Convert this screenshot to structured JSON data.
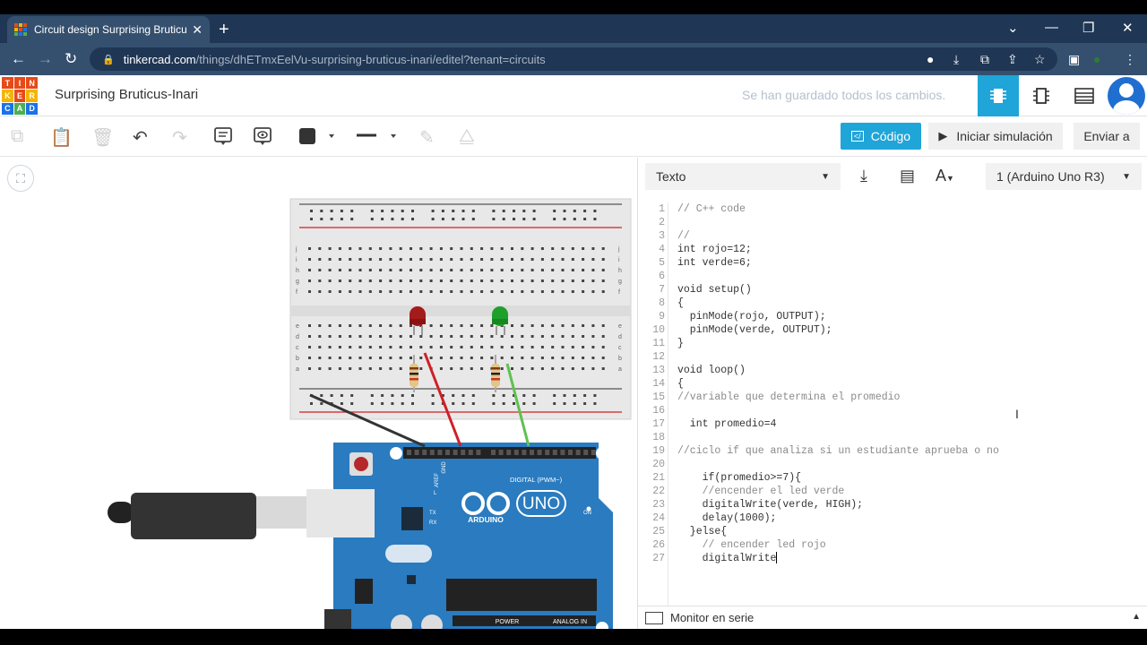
{
  "browser": {
    "tab_title": "Circuit design Surprising Bruticus-Inari",
    "tab_close": "✕",
    "new_tab": "+",
    "url_domain": "tinkercad.com",
    "url_path": "/things/dhETmxEelVu-surprising-bruticus-inari/editel?tenant=circuits"
  },
  "logo": {
    "letters": [
      "T",
      "I",
      "N",
      "K",
      "E",
      "R",
      "C",
      "A",
      "D"
    ],
    "colors": [
      "#e64a19",
      "#e64a19",
      "#e64a19",
      "#f4b400",
      "#e64a19",
      "#f4b400",
      "#1a73e8",
      "#4caf50",
      "#1a73e8"
    ]
  },
  "header": {
    "project_title": "Surprising Bruticus-Inari",
    "save_status": "Se han guardado todos los cambios."
  },
  "toolbar": {
    "code_button": "Código",
    "code_icon_label": "</",
    "simulate_button": "Iniciar simulación",
    "send_button": "Enviar a"
  },
  "code_panel": {
    "mode_select": "Texto",
    "device_select": "1 (Arduino Uno R3)",
    "serial_monitor": "Monitor en serie"
  },
  "code_lines": [
    {
      "n": "1",
      "t": "// C++ code",
      "c": true
    },
    {
      "n": "2",
      "t": "",
      "c": false
    },
    {
      "n": "3",
      "t": "//",
      "c": true
    },
    {
      "n": "4",
      "t": "int rojo=12;",
      "c": false
    },
    {
      "n": "5",
      "t": "int verde=6;",
      "c": false
    },
    {
      "n": "6",
      "t": "",
      "c": false
    },
    {
      "n": "7",
      "t": "void setup()",
      "c": false
    },
    {
      "n": "8",
      "t": "{",
      "c": false
    },
    {
      "n": "9",
      "t": "  pinMode(rojo, OUTPUT);",
      "c": false
    },
    {
      "n": "10",
      "t": "  pinMode(verde, OUTPUT);",
      "c": false
    },
    {
      "n": "11",
      "t": "}",
      "c": false
    },
    {
      "n": "12",
      "t": "",
      "c": false
    },
    {
      "n": "13",
      "t": "void loop()",
      "c": false
    },
    {
      "n": "14",
      "t": "{",
      "c": false
    },
    {
      "n": "15",
      "t": "//variable que determina el promedio",
      "c": true
    },
    {
      "n": "16",
      "t": "",
      "c": false
    },
    {
      "n": "17",
      "t": "  int promedio=4",
      "c": false
    },
    {
      "n": "18",
      "t": "",
      "c": false
    },
    {
      "n": "19",
      "t": "//ciclo if que analiza si un estudiante aprueba o no",
      "c": true
    },
    {
      "n": "20",
      "t": "",
      "c": false
    },
    {
      "n": "21",
      "t": "    if(promedio>=7){",
      "c": false
    },
    {
      "n": "22",
      "t": "    //encender el led verde",
      "c": true
    },
    {
      "n": "23",
      "t": "    digitalWrite(verde, HIGH);",
      "c": false
    },
    {
      "n": "24",
      "t": "    delay(1000);",
      "c": false
    },
    {
      "n": "25",
      "t": "  }else{",
      "c": false
    },
    {
      "n": "26",
      "t": "    // encender led rojo",
      "c": true
    },
    {
      "n": "27",
      "t": "    digitalWrite",
      "c": false
    }
  ],
  "breadboard": {
    "row_letters_top": [
      "j",
      "i",
      "h",
      "g",
      "f"
    ],
    "row_letters_bottom": [
      "e",
      "d",
      "c",
      "b",
      "a"
    ]
  },
  "arduino": {
    "brand": "ARDUINO",
    "model": "UNO",
    "digital_label": "DIGITAL (PWM~)",
    "power_label": "POWER",
    "analog_label": "ANALOG IN",
    "aref_label": "AREF",
    "gnd_label": "GND",
    "on_label": "ON",
    "tx_label": "TX",
    "rx_label": "RX",
    "l_label": "L"
  },
  "colors": {
    "accent": "#1fa5d8",
    "arduino": "#2a7bbf",
    "led_red": "#a31b1b",
    "led_green": "#1fa02a",
    "wire_red": "#d11f26",
    "wire_green": "#5fc150",
    "wire_black": "#333333"
  }
}
